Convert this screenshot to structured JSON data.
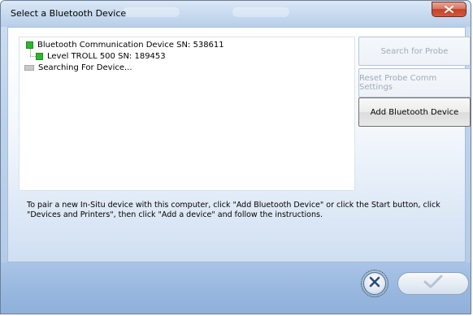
{
  "window": {
    "title": "Select a Bluetooth Device",
    "close_icon": "close-icon"
  },
  "device_tree": {
    "items": [
      {
        "label": "Bluetooth Communication Device SN: 538611",
        "status_color": "#2fb52f",
        "level": 0
      },
      {
        "label": "Level TROLL 500 SN: 189453",
        "status_color": "#2fb52f",
        "level": 1
      },
      {
        "label": "Searching For Device...",
        "status_color": "#c9c9c9",
        "level": 0
      }
    ]
  },
  "buttons": {
    "search_for_probe": {
      "label": "Search for Probe",
      "enabled": false
    },
    "reset_probe_comm": {
      "label": "Reset Probe Comm Settings",
      "enabled": false
    },
    "add_bluetooth_device": {
      "label": "Add Bluetooth Device",
      "enabled": true
    }
  },
  "instructions": {
    "line1": "To pair a new In-Situ device with this computer, click \"Add Bluetooth Device\" or click the Start button, click",
    "line2": "\"Devices and Printers\", then click \"Add a device\" and follow the instructions."
  },
  "footer": {
    "cancel_icon": "cancel-x-icon",
    "ok_icon": "checkmark-icon"
  }
}
